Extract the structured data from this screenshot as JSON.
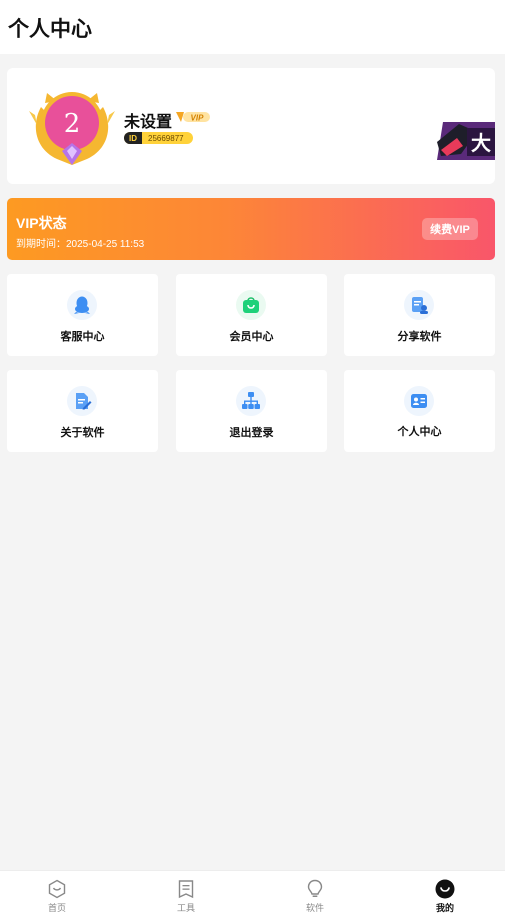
{
  "header": {
    "title": "个人中心"
  },
  "profile": {
    "level_number": "2",
    "username": "未设置",
    "vip_tag": "VIP",
    "id_label": "ID",
    "id_value": "25669877",
    "banner_text": "大"
  },
  "vip": {
    "title": "VIP状态",
    "expire": "到期时间：2025-04-25 11:53",
    "renew_label": "续费VIP"
  },
  "tiles": [
    {
      "label": "客服中心",
      "icon": "qq-icon"
    },
    {
      "label": "会员中心",
      "icon": "shopping-bag-icon"
    },
    {
      "label": "分享软件",
      "icon": "share-icon"
    },
    {
      "label": "关于软件",
      "icon": "document-edit-icon"
    },
    {
      "label": "退出登录",
      "icon": "network-icon"
    },
    {
      "label": "个人中心",
      "icon": "contact-card-icon"
    }
  ],
  "nav": [
    {
      "label": "首页",
      "icon": "home-hexagon-icon"
    },
    {
      "label": "工具",
      "icon": "tool-book-icon"
    },
    {
      "label": "软件",
      "icon": "lightbulb-icon"
    },
    {
      "label": "我的",
      "icon": "smile-profile-icon"
    }
  ],
  "colors": {
    "vip_gradient_start": "#fd9a22",
    "vip_gradient_end": "#f9566a",
    "id_pill": "#ffd23a",
    "medal_pink": "#e8509a",
    "medal_gold": "#f5b731"
  }
}
